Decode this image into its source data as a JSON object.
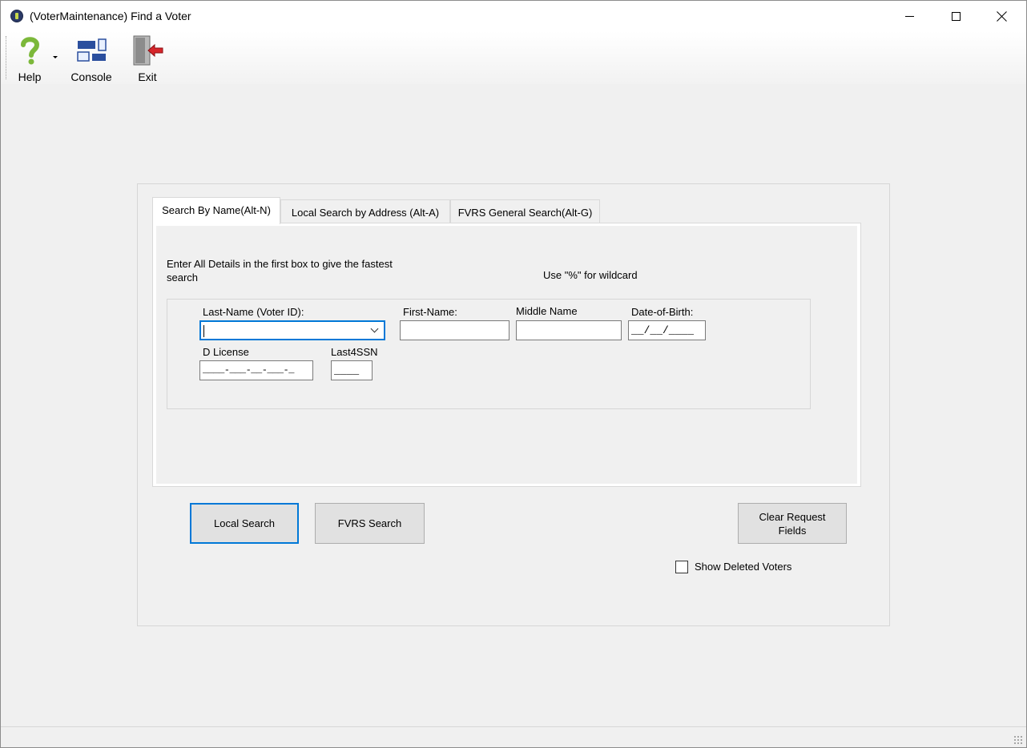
{
  "window": {
    "title": "(VoterMaintenance) Find a Voter",
    "controls": [
      "minimize",
      "maximize",
      "close"
    ]
  },
  "toolbar": {
    "items": [
      {
        "label": "Help",
        "icon": "help-question-icon",
        "has_dropdown": true
      },
      {
        "label": "Console",
        "icon": "console-layout-icon"
      },
      {
        "label": "Exit",
        "icon": "exit-door-icon"
      }
    ]
  },
  "tabs": [
    {
      "label": "Search By Name(Alt-N)",
      "selected": true
    },
    {
      "label": "Local Search by Address (Alt-A)",
      "selected": false
    },
    {
      "label": "FVRS General Search(Alt-G)",
      "selected": false
    }
  ],
  "search_by_name": {
    "hint": "Enter All Details in the first box to give the fastest search",
    "wildcard_note": "Use \"%\" for wildcard",
    "fields": {
      "last_name": {
        "label": "Last-Name (Voter ID):",
        "value": ""
      },
      "first_name": {
        "label": "First-Name:",
        "value": ""
      },
      "middle_name": {
        "label": "Middle Name",
        "value": ""
      },
      "dob": {
        "label": "Date-of-Birth:",
        "mask": "__/__/____"
      },
      "d_license": {
        "label": "D License",
        "mask": "____-___-__-___-_"
      },
      "last4ssn": {
        "label": "Last4SSN",
        "mask": "____"
      }
    }
  },
  "buttons": {
    "local_search": "Local Search",
    "fvrs_search": "FVRS Search",
    "clear_line1": "Clear Request",
    "clear_line2": "Fields"
  },
  "show_deleted": {
    "label": "Show Deleted Voters",
    "checked": false
  },
  "colors": {
    "accent": "#0078d7",
    "help_icon": "#7cb83a",
    "console_icon": "#2b4f9e",
    "exit_arrow": "#d7262b"
  }
}
